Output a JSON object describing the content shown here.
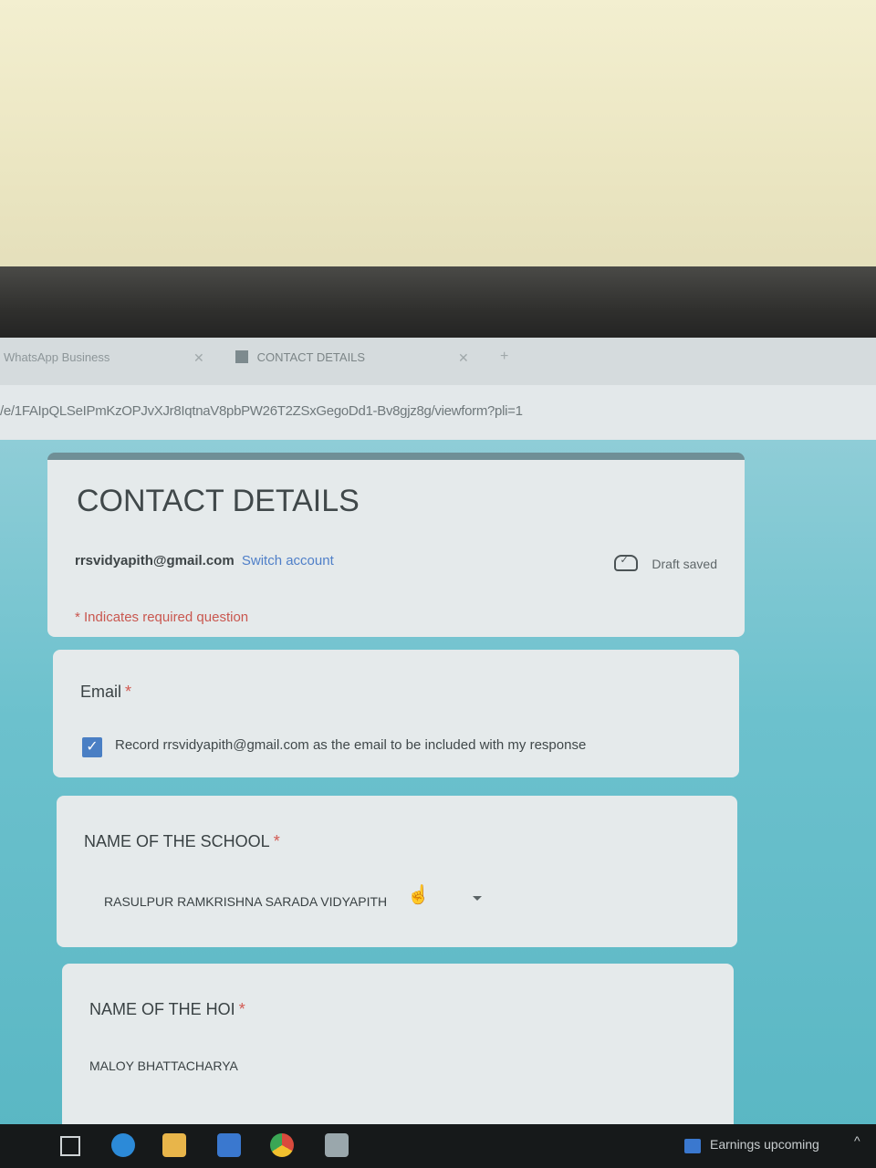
{
  "browser": {
    "tabs": [
      {
        "label": "WhatsApp Business"
      },
      {
        "label": "CONTACT DETAILS"
      }
    ],
    "url": "/e/1FAIpQLSeIPmKzOPJvXJr8IqtnaV8pbPW26T2ZSxGegoDd1-Bv8gjz8g/viewform?pli=1"
  },
  "form": {
    "title": "CONTACT DETAILS",
    "account_email": "rrsvidyapith@gmail.com",
    "switch_account": "Switch account",
    "draft_status": "Draft saved",
    "required_note": "* Indicates required question",
    "questions": [
      {
        "title": "Email",
        "required_mark": "*",
        "checkbox_checked": true,
        "checkbox_label": "Record rrsvidyapith@gmail.com as the email to be included with my response"
      },
      {
        "title": "NAME OF THE SCHOOL",
        "required_mark": "*",
        "answer": "RASULPUR RAMKRISHNA SARADA VIDYAPITH"
      },
      {
        "title": "NAME OF THE HOI",
        "required_mark": "*",
        "answer": "MALOY BHATTACHARYA"
      }
    ]
  },
  "taskbar": {
    "news": "Earnings upcoming"
  },
  "icons": {
    "taskbar": [
      "task-view-icon",
      "edge-icon",
      "file-explorer-icon",
      "mail-icon",
      "chrome-icon",
      "paint-icon"
    ],
    "check": "✓",
    "cursor": "☝",
    "chevron_up": "^"
  },
  "colors": {
    "page_background": "#5ab7c4",
    "header_accent": "#6f8f96",
    "link": "#4f7fc8",
    "required": "#d25a52",
    "checkbox": "#4a7fc4"
  }
}
